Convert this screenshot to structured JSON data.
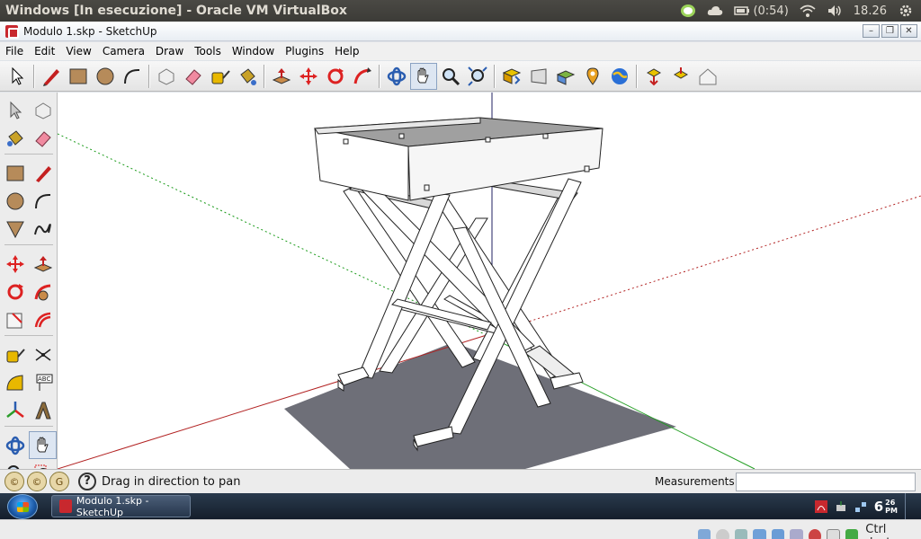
{
  "host_panel": {
    "title": "Windows [In esecuzione] - Oracle VM VirtualBox",
    "battery": "(0:54)",
    "clock": "18.26"
  },
  "app": {
    "window_title": "Modulo 1.skp - SketchUp",
    "menu": [
      "File",
      "Edit",
      "View",
      "Camera",
      "Draw",
      "Tools",
      "Window",
      "Plugins",
      "Help"
    ]
  },
  "toolbar": {
    "tools": [
      "select",
      "line",
      "rectangle",
      "circle",
      "arc",
      "make-component",
      "eraser",
      "tape-measure",
      "paint-bucket",
      "push-pull",
      "move",
      "rotate",
      "follow-me",
      "orbit",
      "pan",
      "zoom",
      "zoom-extents",
      "get-models",
      "share-model",
      "get-photo-textures",
      "add-location",
      "google-earth",
      "share-component",
      "get-components",
      "3d-warehouse"
    ],
    "active": "pan"
  },
  "palette": {
    "tools": [
      "select",
      "make-component",
      "paint-bucket",
      "eraser",
      "rectangle",
      "line",
      "circle",
      "arc",
      "polygon",
      "freehand",
      "move",
      "push-pull",
      "rotate",
      "follow-me",
      "scale",
      "offset",
      "tape-measure",
      "dimension",
      "protractor",
      "text",
      "axes",
      "3d-text",
      "orbit",
      "pan",
      "zoom",
      "zoom-window"
    ]
  },
  "status": {
    "hint": "Drag in direction to pan",
    "measurements_label": "Measurements",
    "measurements_value": ""
  },
  "taskbar": {
    "task_label": "Modulo 1.skp - SketchUp",
    "clock_hour": "6",
    "clock_min": "26",
    "clock_ampm": "PM"
  },
  "vbox": {
    "host_key": "Ctrl destro"
  },
  "colors": {
    "axis_red": "#b22222",
    "axis_green": "#1f9d1f",
    "axis_blue": "#202060",
    "ground": "#6e6f78",
    "sketchup_red": "#c8282e"
  }
}
